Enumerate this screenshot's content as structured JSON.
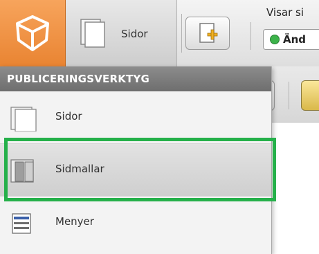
{
  "toolbar": {
    "sidor_tab_label": "Sidor",
    "visar_label": "Visar si",
    "andra_label": "Änd"
  },
  "menu": {
    "header": "PUBLICERINGSVERKTYG",
    "items": [
      {
        "label": "Sidor",
        "icon": "single-page-icon"
      },
      {
        "label": "Sidmallar",
        "icon": "page-templates-icon"
      },
      {
        "label": "Menyer",
        "icon": "menu-list-icon"
      }
    ]
  },
  "colors": {
    "brand_orange": "#e98432",
    "highlight_green": "#25b04a",
    "header_gray": "#7d7d7d"
  }
}
